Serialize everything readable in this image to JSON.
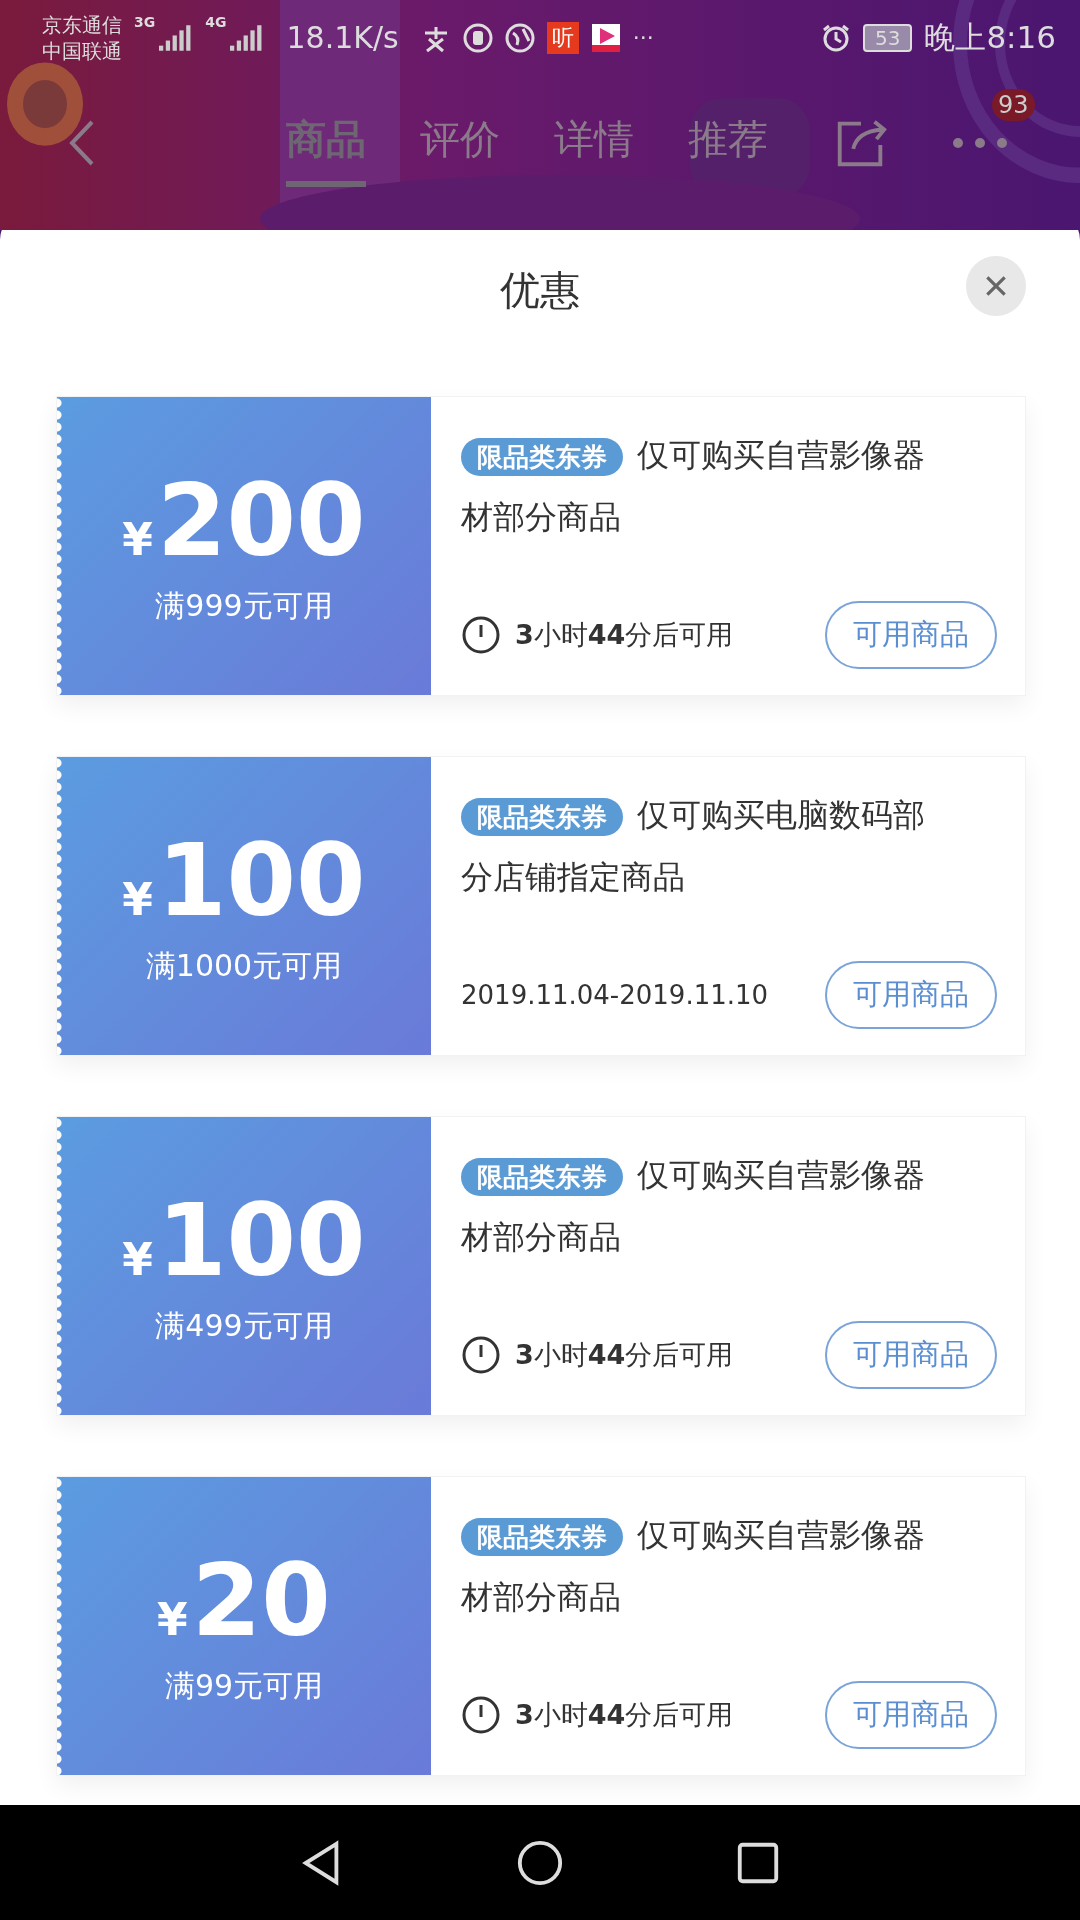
{
  "status_bar": {
    "carriers": [
      "京东通信",
      "中国联通"
    ],
    "networks": [
      "3G",
      "4G"
    ],
    "speed": "18.1K/s",
    "app_badge": "听",
    "more": "···",
    "battery": "53",
    "time": "晚上8:16"
  },
  "nav": {
    "tabs": [
      {
        "label": "商品",
        "selected": true
      },
      {
        "label": "评价",
        "selected": false
      },
      {
        "label": "详情",
        "selected": false
      },
      {
        "label": "推荐",
        "selected": false
      }
    ],
    "badge": "93"
  },
  "sheet": {
    "title": "优惠"
  },
  "coupons": [
    {
      "currency": "¥",
      "amount": "200",
      "condition": "满999元可用",
      "tag": "限品类东券",
      "description": "仅可购买自营影像器材部分商品",
      "validity": {
        "kind": "countdown",
        "text": "**3**小时**44**分后可用"
      },
      "button": "可用商品"
    },
    {
      "currency": "¥",
      "amount": "100",
      "condition": "满1000元可用",
      "tag": "限品类东券",
      "description": "仅可购买电脑数码部分店铺指定商品",
      "validity": {
        "kind": "date",
        "text": "2019.11.04-2019.11.10"
      },
      "button": "可用商品"
    },
    {
      "currency": "¥",
      "amount": "100",
      "condition": "满499元可用",
      "tag": "限品类东券",
      "description": "仅可购买自营影像器材部分商品",
      "validity": {
        "kind": "countdown",
        "text": "**3**小时**44**分后可用"
      },
      "button": "可用商品"
    },
    {
      "currency": "¥",
      "amount": "20",
      "condition": "满99元可用",
      "tag": "限品类东券",
      "description": "仅可购买自营影像器材部分商品",
      "validity": {
        "kind": "countdown",
        "text": "**3**小时**44**分后可用"
      },
      "button": "可用商品"
    }
  ]
}
